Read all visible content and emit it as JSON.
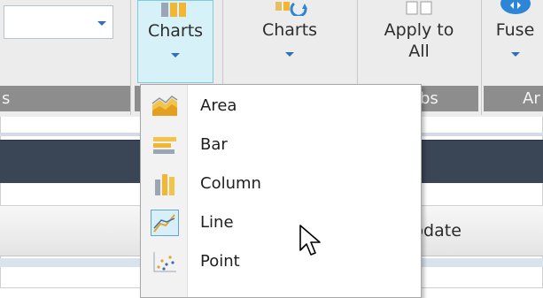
{
  "ribbon": {
    "combo_value": "",
    "buttons": [
      {
        "line1": "Charts",
        "line2": ""
      },
      {
        "line1": "Charts",
        "line2": ""
      },
      {
        "line1": "Apply to",
        "line2": "All"
      },
      {
        "line1": "Fuse",
        "line2": ""
      }
    ],
    "groups": [
      {
        "label": "s"
      },
      {
        "label": "bs"
      },
      {
        "label": "Ar"
      }
    ]
  },
  "grid": {
    "column_header_fragment": "pdate"
  },
  "menu": {
    "items": [
      {
        "label": "Area",
        "icon": "area-chart-icon",
        "selected": false
      },
      {
        "label": "Bar",
        "icon": "bar-chart-icon",
        "selected": false
      },
      {
        "label": "Column",
        "icon": "column-chart-icon",
        "selected": false
      },
      {
        "label": "Line",
        "icon": "line-chart-icon",
        "selected": true
      },
      {
        "label": "Point",
        "icon": "point-chart-icon",
        "selected": false
      }
    ]
  },
  "colors": {
    "accent": "#2f6fbd",
    "selected_bg": "#d6f1f8",
    "dark_bar": "#3a4556",
    "group_bar": "#8d8d8d"
  }
}
